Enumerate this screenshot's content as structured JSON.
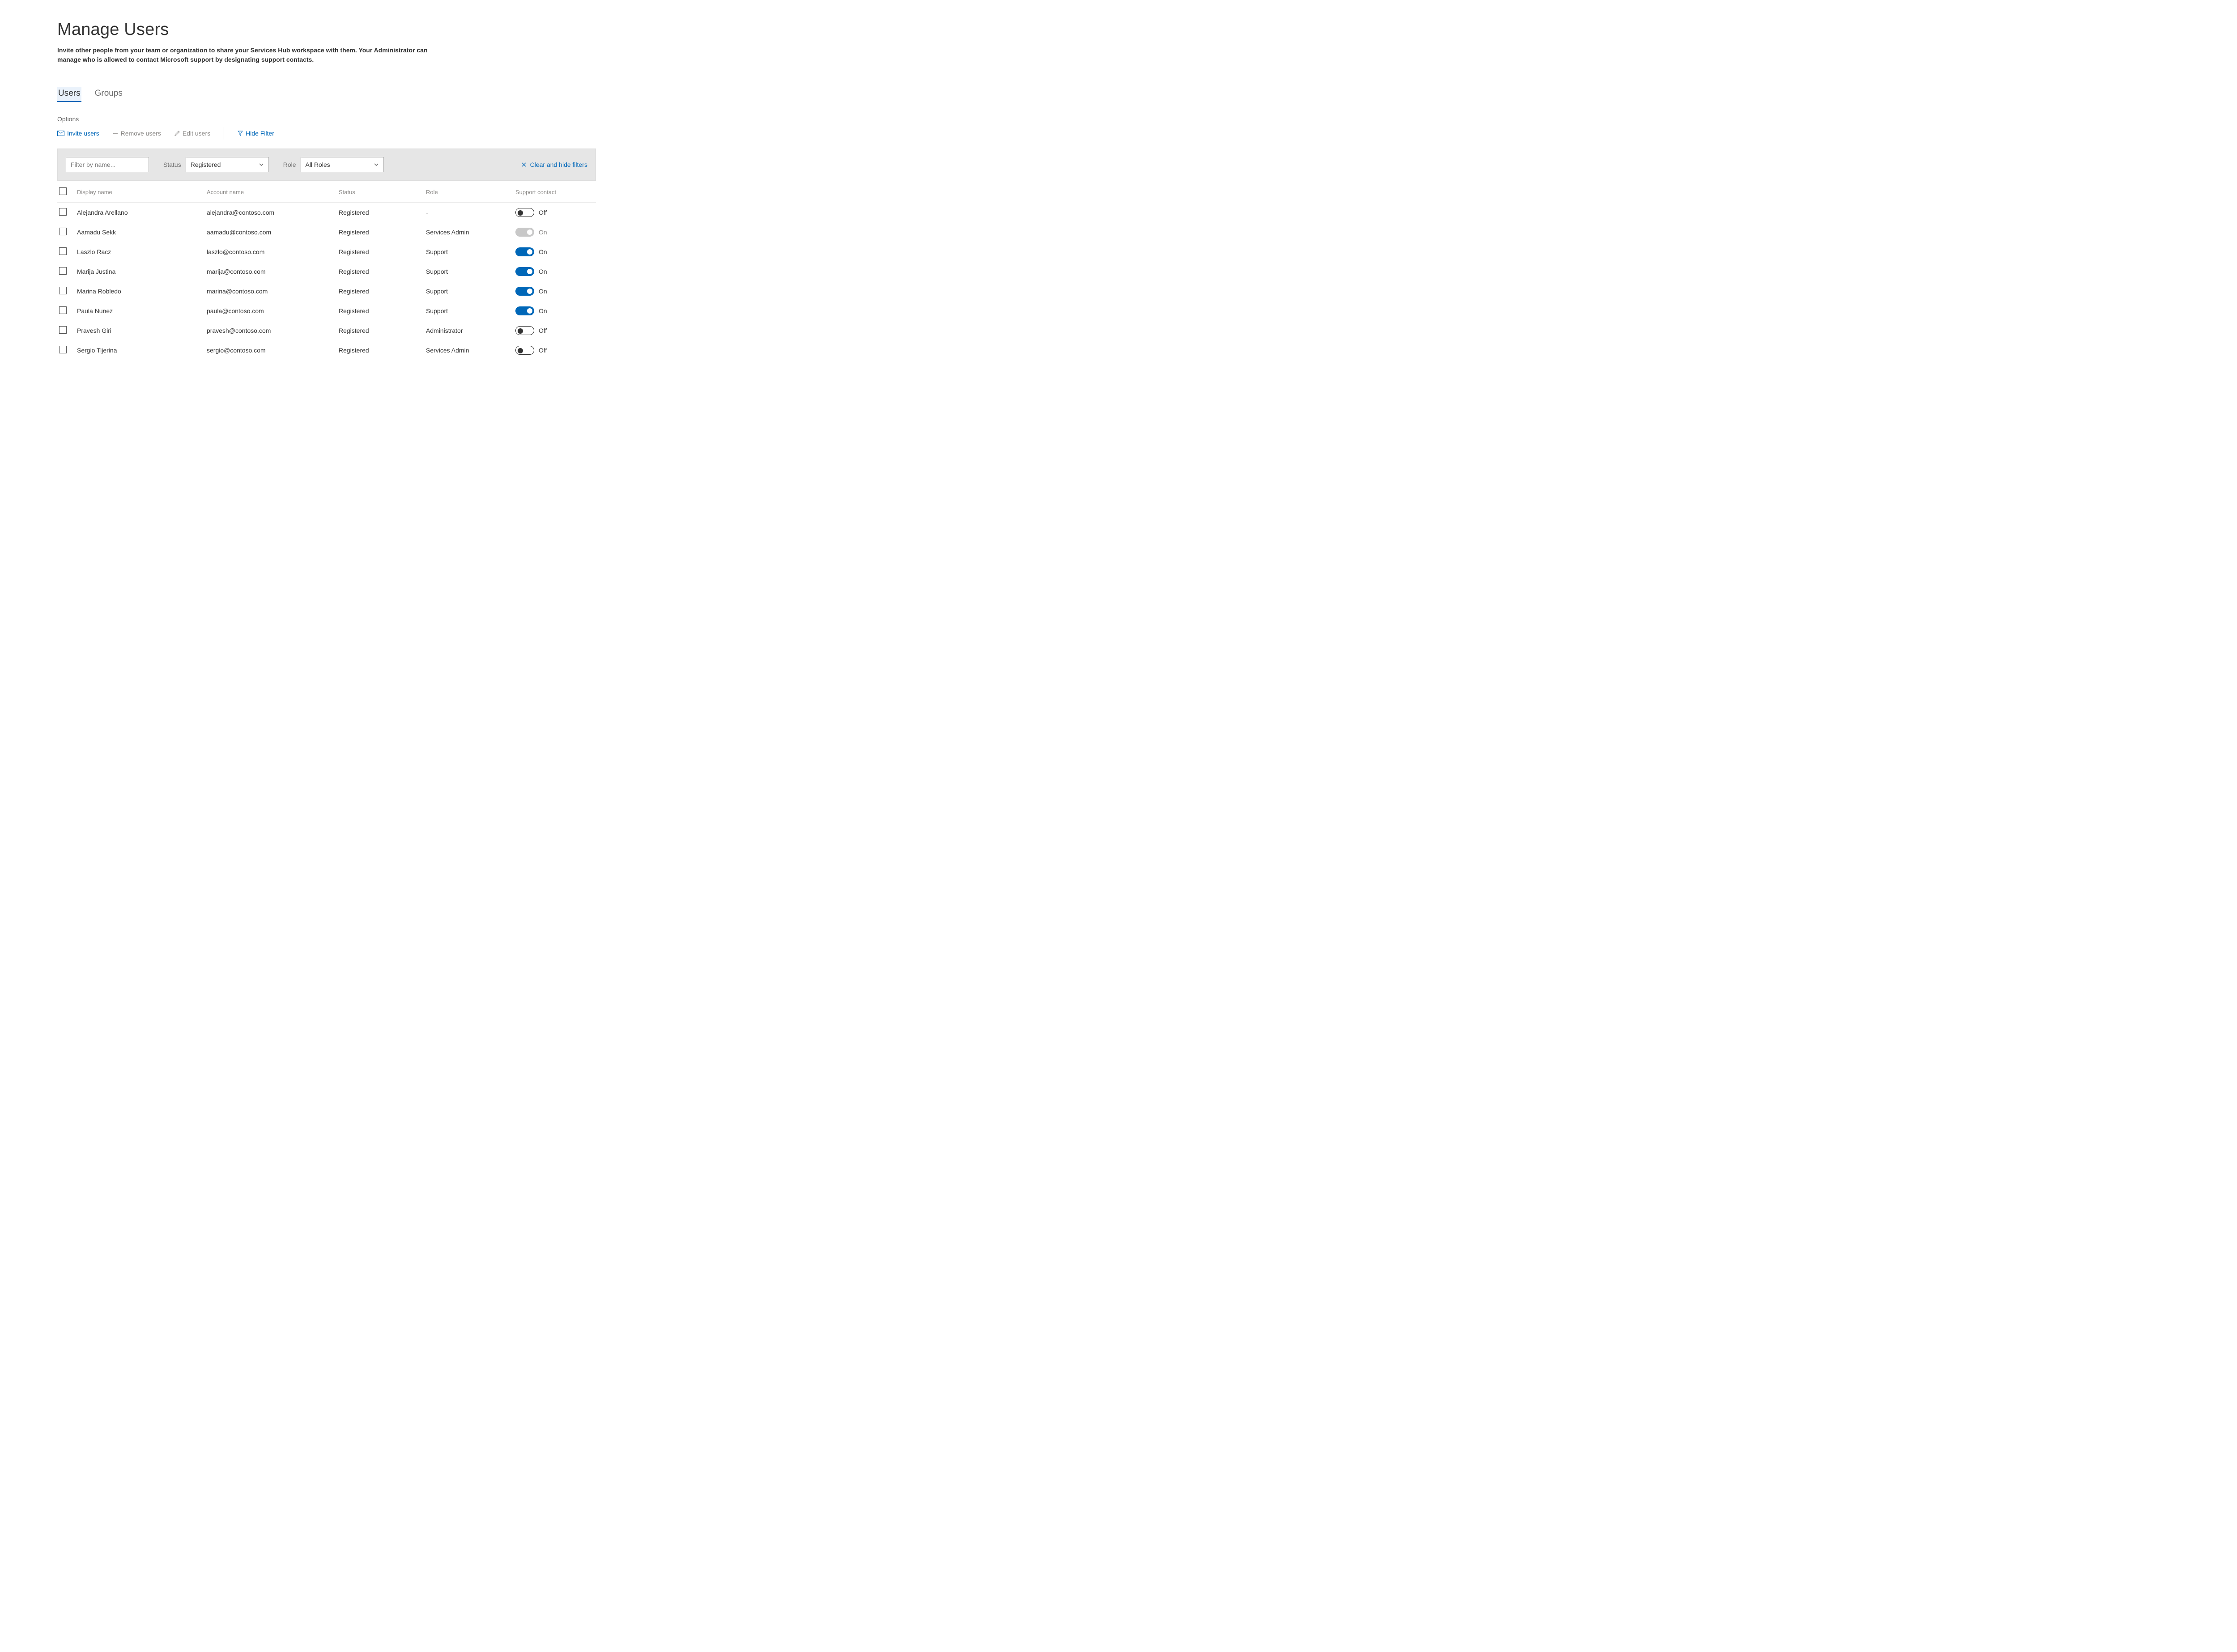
{
  "page": {
    "title": "Manage Users",
    "description": "Invite other people from your team or organization to share your Services Hub workspace with them. Your Administrator can manage who is allowed to contact Microsoft support by designating support contacts."
  },
  "tabs": {
    "users": "Users",
    "groups": "Groups",
    "active": "users"
  },
  "optionsLabel": "Options",
  "toolbar": {
    "invite": "Invite users",
    "remove": "Remove users",
    "edit": "Edit users",
    "hideFilter": "Hide Filter"
  },
  "filters": {
    "namePlaceholder": "Filter by name...",
    "statusLabel": "Status",
    "statusValue": "Registered",
    "roleLabel": "Role",
    "roleValue": "All Roles",
    "clear": "Clear and hide filters"
  },
  "columns": {
    "display": "Display name",
    "account": "Account name",
    "status": "Status",
    "role": "Role",
    "support": "Support contact"
  },
  "rows": [
    {
      "display": "Alejandra Arellano",
      "account": "alejandra@contoso.com",
      "status": "Registered",
      "role": "-",
      "toggle": "off",
      "toggleLabel": "Off"
    },
    {
      "display": "Aamadu Sekk",
      "account": "aamadu@contoso.com",
      "status": "Registered",
      "role": "Services Admin",
      "toggle": "disabled",
      "toggleLabel": "On"
    },
    {
      "display": "Laszlo Racz",
      "account": "laszlo@contoso.com",
      "status": "Registered",
      "role": "Support",
      "toggle": "on",
      "toggleLabel": "On"
    },
    {
      "display": "Marija Justina",
      "account": "marija@contoso.com",
      "status": "Registered",
      "role": "Support",
      "toggle": "on",
      "toggleLabel": "On"
    },
    {
      "display": "Marina Robledo",
      "account": "marina@contoso.com",
      "status": "Registered",
      "role": "Support",
      "toggle": "on",
      "toggleLabel": "On"
    },
    {
      "display": "Paula Nunez",
      "account": "paula@contoso.com",
      "status": "Registered",
      "role": "Support",
      "toggle": "on",
      "toggleLabel": "On"
    },
    {
      "display": "Pravesh Giri",
      "account": "pravesh@contoso.com",
      "status": "Registered",
      "role": "Administrator",
      "toggle": "off",
      "toggleLabel": "Off"
    },
    {
      "display": "Sergio Tijerina",
      "account": "sergio@contoso.com",
      "status": "Registered",
      "role": "Services Admin",
      "toggle": "off",
      "toggleLabel": "Off"
    }
  ]
}
